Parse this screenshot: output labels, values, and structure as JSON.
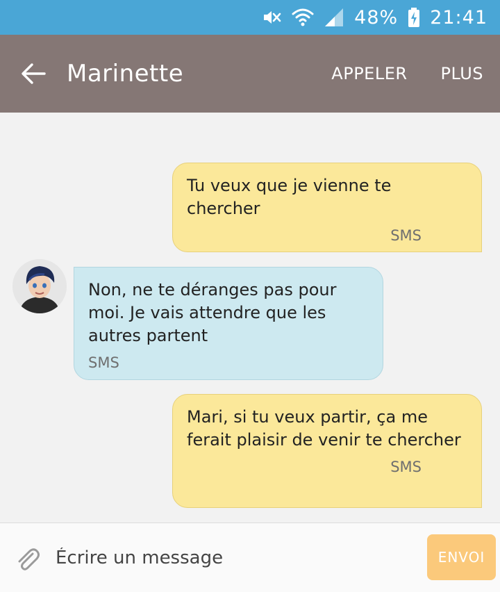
{
  "status_bar": {
    "battery_percent": "48%",
    "time": "21:41",
    "icons": [
      "mute-icon",
      "wifi-icon",
      "signal-icon",
      "battery-charging-icon"
    ]
  },
  "app_bar": {
    "title": "Marinette",
    "call_label": "APPELER",
    "more_label": "PLUS"
  },
  "messages": [
    {
      "direction": "outgoing",
      "text": "Tu veux que je vienne te chercher",
      "type": "SMS"
    },
    {
      "direction": "incoming",
      "text": "Non, ne te déranges pas pour moi. Je vais attendre que les autres partent",
      "type": "SMS"
    },
    {
      "direction": "outgoing",
      "text": "Mari, si tu veux partir, ça me ferait plaisir de venir te chercher",
      "type": "SMS"
    }
  ],
  "composer": {
    "placeholder": "Écrire un message",
    "send_label": "ENVOI"
  },
  "colors": {
    "status_bar": "#4aa6d6",
    "app_bar": "#857775",
    "outgoing_bubble": "#fbe89a",
    "incoming_bubble": "#cde9f0",
    "send_button": "#fbc97b"
  }
}
